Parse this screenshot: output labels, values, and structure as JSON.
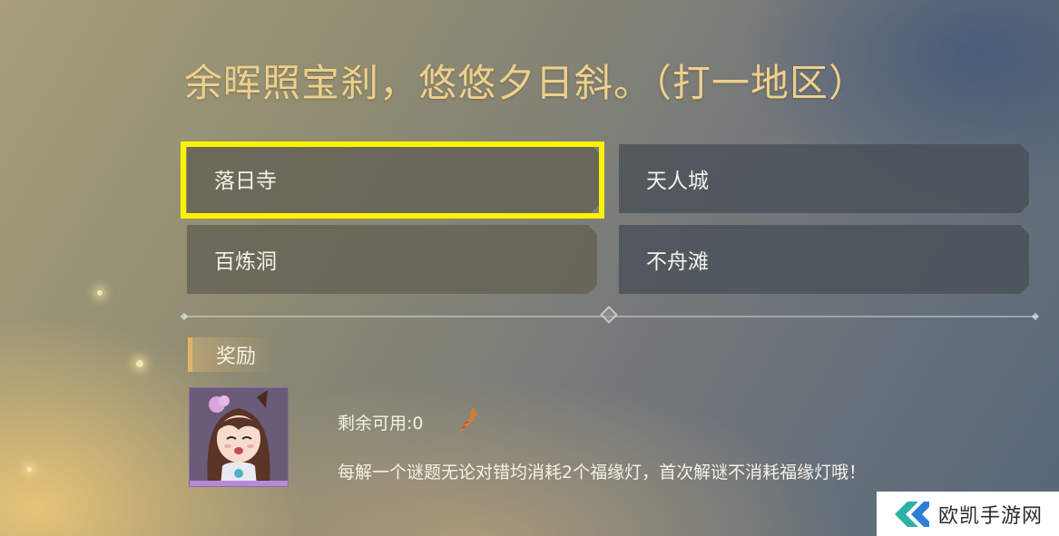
{
  "riddle": {
    "title": "余晖照宝刹，悠悠夕日斜。（打一地区）"
  },
  "options": [
    {
      "label": "落日寺",
      "selected": true
    },
    {
      "label": "天人城",
      "selected": false
    },
    {
      "label": "百炼洞",
      "selected": false
    },
    {
      "label": "不舟滩",
      "selected": false
    }
  ],
  "reward": {
    "header": "奖励",
    "remaining": "剩余可用:0",
    "note": "每解一个谜题无论对错均消耗2个福缘灯，首次解谜不消耗福缘灯哦！"
  },
  "watermark": {
    "text": "欧凯手游网"
  },
  "colors": {
    "title": "#efcf8b",
    "highlight": "#fff200",
    "reward_accent": "#e2b26a"
  },
  "icons": {
    "remaining": "carrot-icon",
    "divider": "diamond-icon",
    "watermark": "ok-logo-icon"
  }
}
